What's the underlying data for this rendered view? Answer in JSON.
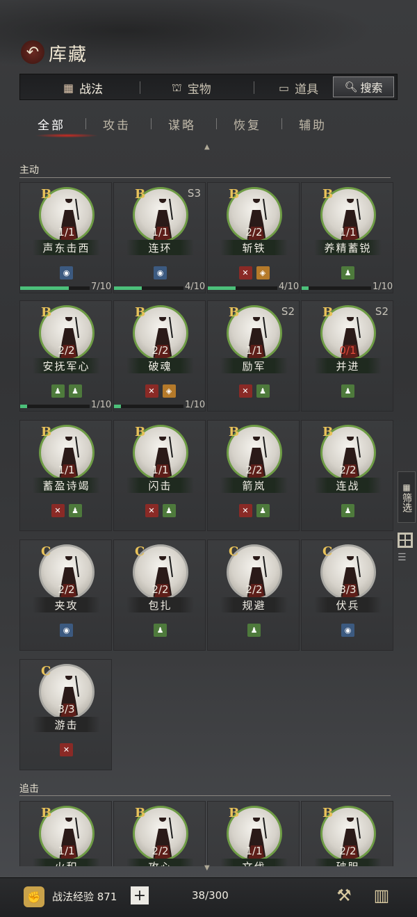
{
  "header": {
    "title": "库藏",
    "back_icon": "back-arrow-icon"
  },
  "tabs": [
    {
      "label": "战法",
      "icon": "scroll-icon",
      "active": true
    },
    {
      "label": "宝物",
      "icon": "treasure-icon",
      "active": false
    },
    {
      "label": "道具",
      "icon": "item-icon",
      "active": false
    }
  ],
  "search": {
    "label": "搜索"
  },
  "subtabs": [
    {
      "label": "全部",
      "active": true
    },
    {
      "label": "攻击",
      "active": false
    },
    {
      "label": "谋略",
      "active": false
    },
    {
      "label": "恢复",
      "active": false
    },
    {
      "label": "辅助",
      "active": false
    }
  ],
  "sections": {
    "active": "主动",
    "pursuit": "追击"
  },
  "cards": [
    {
      "name": "声东击西",
      "grade": "B",
      "season": "",
      "count": "1/1",
      "tags": [
        "blue"
      ],
      "progress": 0.7,
      "progress_text": "7/10"
    },
    {
      "name": "连环",
      "grade": "B",
      "season": "S3",
      "count": "1/1",
      "tags": [
        "blue"
      ],
      "progress": 0.4,
      "progress_text": "4/10"
    },
    {
      "name": "斩铁",
      "grade": "B",
      "season": "",
      "count": "2/2",
      "tags": [
        "atk",
        "orange"
      ],
      "progress": 0.4,
      "progress_text": "4/10"
    },
    {
      "name": "养精蓄锐",
      "grade": "B",
      "season": "",
      "count": "1/1",
      "tags": [
        "green"
      ],
      "progress": 0.1,
      "progress_text": "1/10"
    },
    {
      "name": "安抚军心",
      "grade": "B",
      "season": "",
      "count": "2/2",
      "tags": [
        "green",
        "green"
      ],
      "progress": 0.1,
      "progress_text": "1/10"
    },
    {
      "name": "破魂",
      "grade": "B",
      "season": "",
      "count": "2/2",
      "tags": [
        "atk",
        "orange"
      ],
      "progress": 0.1,
      "progress_text": "1/10"
    },
    {
      "name": "励军",
      "grade": "B",
      "season": "S2",
      "count": "1/1",
      "tags": [
        "atk",
        "green"
      ],
      "progress": null,
      "progress_text": ""
    },
    {
      "name": "并进",
      "grade": "B",
      "season": "S2",
      "count": "0/1",
      "count_red": true,
      "tags": [
        "green"
      ],
      "progress": null,
      "progress_text": ""
    },
    {
      "name": "蓄盈诗竭",
      "grade": "B",
      "season": "",
      "count": "1/1",
      "tags": [
        "atk",
        "green"
      ],
      "progress": null,
      "progress_text": ""
    },
    {
      "name": "闪击",
      "grade": "B",
      "season": "",
      "count": "1/1",
      "tags": [
        "atk",
        "green"
      ],
      "progress": null,
      "progress_text": ""
    },
    {
      "name": "箭岚",
      "grade": "B",
      "season": "",
      "count": "2/2",
      "tags": [
        "atk",
        "green"
      ],
      "progress": null,
      "progress_text": ""
    },
    {
      "name": "连战",
      "grade": "B",
      "season": "",
      "count": "2/2",
      "tags": [
        "green"
      ],
      "progress": null,
      "progress_text": ""
    },
    {
      "name": "夹攻",
      "grade": "C",
      "season": "",
      "count": "2/2",
      "tags": [
        "blue"
      ],
      "progress": null,
      "progress_text": ""
    },
    {
      "name": "包扎",
      "grade": "C",
      "season": "",
      "count": "2/2",
      "tags": [
        "green"
      ],
      "progress": null,
      "progress_text": ""
    },
    {
      "name": "规避",
      "grade": "C",
      "season": "",
      "count": "2/2",
      "tags": [
        "green"
      ],
      "progress": null,
      "progress_text": ""
    },
    {
      "name": "伏兵",
      "grade": "C",
      "season": "",
      "count": "3/3",
      "tags": [
        "blue"
      ],
      "progress": null,
      "progress_text": ""
    },
    {
      "name": "游击",
      "grade": "C",
      "season": "",
      "count": "3/3",
      "tags": [
        "atk"
      ],
      "progress": null,
      "progress_text": ""
    }
  ],
  "pursuit_cards": [
    {
      "name": "火积",
      "grade": "B",
      "count": "1/1"
    },
    {
      "name": "攻心",
      "grade": "B",
      "count": "2/2"
    },
    {
      "name": "文伐",
      "grade": "B",
      "count": "1/1"
    },
    {
      "name": "破胆",
      "grade": "B",
      "count": "2/2"
    }
  ],
  "side_panel": {
    "filter_label": "筛选"
  },
  "footer": {
    "exp_label": "战法经验 871",
    "plus": "+",
    "capacity": "38/300"
  },
  "colors": {
    "accent_green": "#6e9c45",
    "grade_gold": "#e8c25a",
    "progress_green": "#4cc07a",
    "attack_red": "#8a2a26",
    "count_red": "#e04a3a"
  }
}
